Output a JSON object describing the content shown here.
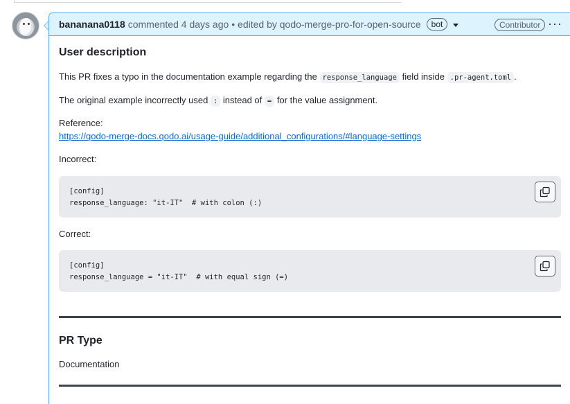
{
  "comment": {
    "author": "bananana0118",
    "action": "commented 4 days ago",
    "edited": "• edited by qodo-merge-pro-for-open-source",
    "bot_badge": "bot",
    "role_badge": "Contributor",
    "menu_glyph": "···"
  },
  "content": {
    "heading_user_desc": "User description",
    "p1_a": "This PR fixes a typo in the documentation example regarding the ",
    "p1_code1": "response_language",
    "p1_b": " field inside ",
    "p1_code2": ".pr-agent.toml",
    "p1_c": ".",
    "p2_a": "The original example incorrectly used ",
    "p2_code1": ":",
    "p2_b": " instead of ",
    "p2_code2": "=",
    "p2_c": " for the value assignment.",
    "reference_label": "Reference:",
    "reference_link": "https://qodo-merge-docs.qodo.ai/usage-guide/additional_configurations/#language-settings",
    "incorrect_label": "Incorrect:",
    "incorrect_code": "[config]\nresponse_language: \"it-IT\"  # with colon (:)",
    "correct_label": "Correct:",
    "correct_code": "[config]\nresponse_language = \"it-IT\"  # with equal sign (=)",
    "heading_pr_type": "PR Type",
    "pr_type_value": "Documentation"
  }
}
